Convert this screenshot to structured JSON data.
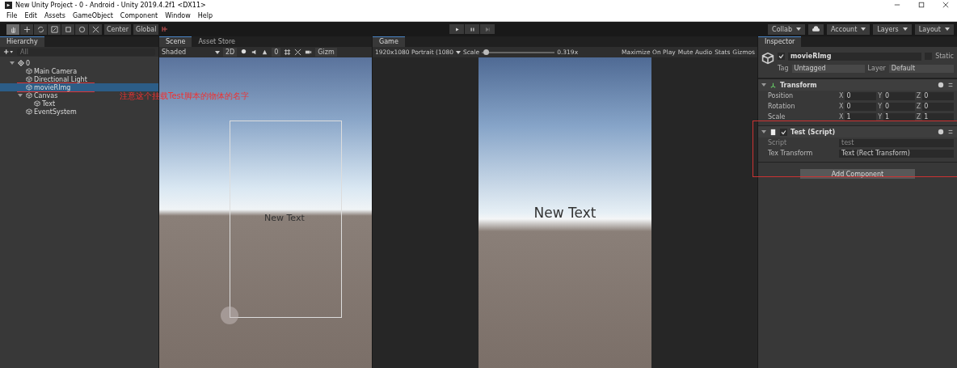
{
  "window": {
    "title": "New Unity Project - 0 - Android - Unity 2019.4.2f1 <DX11>"
  },
  "menu": [
    "File",
    "Edit",
    "Assets",
    "GameObject",
    "Component",
    "Window",
    "Help"
  ],
  "toolbar": {
    "tools": [
      {
        "kind": "hand",
        "selected": true
      },
      {
        "kind": "move",
        "selected": false
      },
      {
        "kind": "rotate",
        "selected": false
      },
      {
        "kind": "scale",
        "selected": false
      },
      {
        "kind": "rect",
        "selected": false
      },
      {
        "kind": "transform",
        "selected": false
      },
      {
        "kind": "custom",
        "selected": false
      }
    ],
    "pivot": [
      "Center",
      "Global"
    ],
    "right": [
      {
        "label": "Collab",
        "kind": "dropdown"
      },
      {
        "kind": "cloud"
      },
      {
        "label": "Account",
        "kind": "dropdown"
      },
      {
        "label": "Layers",
        "kind": "dropdown"
      },
      {
        "label": "Layout",
        "kind": "dropdown"
      }
    ]
  },
  "hierarchy": {
    "tab": "Hierarchy",
    "search": {
      "placeholder": "All"
    },
    "tree": [
      {
        "label": "0",
        "kind": "scene",
        "expanded": true,
        "selected": false,
        "children": [
          {
            "label": "Main Camera",
            "kind": "object",
            "selected": false
          },
          {
            "label": "Directional Light",
            "kind": "object",
            "selected": false
          },
          {
            "label": "movieRImg",
            "kind": "object",
            "selected": true
          },
          {
            "label": "Canvas",
            "kind": "object",
            "expanded": true,
            "selected": false,
            "children": [
              {
                "label": "Text",
                "kind": "object",
                "selected": false
              }
            ]
          },
          {
            "label": "EventSystem",
            "kind": "object",
            "selected": false
          }
        ]
      }
    ],
    "annotation": "注意这个挂载Test脚本的物体的名字"
  },
  "scene": {
    "tabs": [
      {
        "label": "Scene",
        "selected": true
      },
      {
        "label": "Asset Store",
        "selected": false
      }
    ],
    "shading": "Shaded",
    "mode_2d": "2D",
    "hidden_count": "0",
    "gizmos": "Gizm",
    "text": "New Text"
  },
  "game": {
    "tab": "Game",
    "resolution": "1920x1080 Portrait (1080",
    "scale_label": "Scale",
    "scale": {
      "level": 0.02
    },
    "scale_value": "0.319x",
    "buttons": [
      "Maximize On Play",
      "Mute Audio",
      "Stats",
      "Gizmos"
    ],
    "text": "New Text"
  },
  "inspector": {
    "tab": "Inspector",
    "object": {
      "active": true,
      "name": "movieRImg",
      "static_label": "Static",
      "static": false,
      "tag_label": "Tag",
      "tag": "Untagged",
      "layer_label": "Layer",
      "layer": "Default"
    },
    "components": [
      {
        "kind": "transform",
        "title": "Transform",
        "rows": [
          {
            "label": "Position",
            "values": [
              {
                "axis": "X",
                "value": "0"
              },
              {
                "axis": "Y",
                "value": "0"
              },
              {
                "axis": "Z",
                "value": "0"
              }
            ]
          },
          {
            "label": "Rotation",
            "values": [
              {
                "axis": "X",
                "value": "0"
              },
              {
                "axis": "Y",
                "value": "0"
              },
              {
                "axis": "Z",
                "value": "0"
              }
            ]
          },
          {
            "label": "Scale",
            "values": [
              {
                "axis": "X",
                "value": "1"
              },
              {
                "axis": "Y",
                "value": "1"
              },
              {
                "axis": "Z",
                "value": "1"
              }
            ]
          }
        ]
      },
      {
        "kind": "script",
        "title": "Test (Script)",
        "enabled": true,
        "fields": [
          {
            "label": "Script",
            "value": "test",
            "disabled": true
          },
          {
            "label": "Tex Transform",
            "value": "Text (Rect Transform)",
            "disabled": false
          }
        ]
      }
    ],
    "add_component": "Add Component"
  }
}
